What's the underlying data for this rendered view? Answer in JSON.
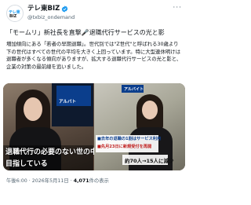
{
  "account": {
    "name": "テレ東BIZ",
    "handle": "@txbiz_ondemand",
    "avatar_lines": [
      "テレ東",
      "BIZ"
    ],
    "verified_color": "#1d9bf0"
  },
  "more_label": "···",
  "post": {
    "title_pre": "「モームリ」新社長を直撃",
    "title_icon": "🎤",
    "title_post": "退職代行サービスの光と影",
    "body": "増加傾向にある「若者の早期退職」。世代別では\"Z世代\"と呼ばれる30歳より下の世代はすべての世代の平均を大きく上回っています。特に大型連休明けは退職者が多くなる傾向がありますが、拡大する退職代行サービスの光と影と、企業の対策の最前線を追いました。"
  },
  "media": {
    "left": {
      "logo": "アルバト",
      "caption_line1": "退職代行の必要のない世の中を",
      "caption_line2": "目指している"
    },
    "right": {
      "tag": "アルバイト",
      "banner_line1": "■去年の退職の1割はサービス利用",
      "banner_line2": "■先月23日に新規受付を再開",
      "stat": "約70人→15人に減少"
    }
  },
  "meta": {
    "time": "午後6:00",
    "date": "2026年5月11日",
    "views_count": "4,071",
    "views_label": "件の表示",
    "sep": " · "
  }
}
